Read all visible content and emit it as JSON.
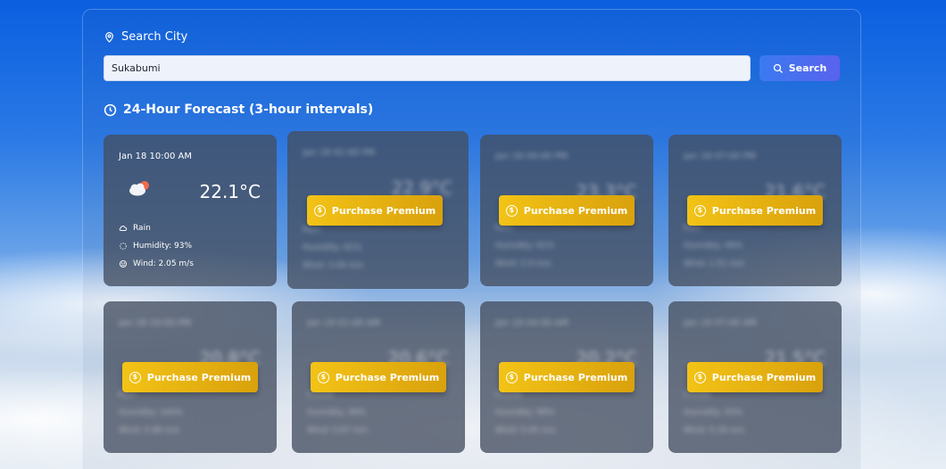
{
  "search": {
    "label": "Search City",
    "value": "Sukabumi",
    "button_label": "Search"
  },
  "forecast": {
    "heading": "24-Hour Forecast (3-hour intervals)",
    "premium_label": "Purchase Premium",
    "cards": [
      {
        "time": "Jan 18 10:00 AM",
        "temp": "22.1°C",
        "condition": "Rain",
        "humidity": "Humidity: 93%",
        "wind": "Wind: 2.05 m/s",
        "locked": false
      },
      {
        "time": "Jan 18 01:00 PM",
        "temp": "22.9°C",
        "condition": "Rain",
        "humidity": "Humidity: 91%",
        "wind": "Wind: 3.04 m/s",
        "locked": true
      },
      {
        "time": "Jan 18 04:00 PM",
        "temp": "23.3°C",
        "condition": "Rain",
        "humidity": "Humidity: 91%",
        "wind": "Wind: 2.4 m/s",
        "locked": true
      },
      {
        "time": "Jan 18 07:00 PM",
        "temp": "21.6°C",
        "condition": "Rain",
        "humidity": "Humidity: 99%",
        "wind": "Wind: 1.51 m/s",
        "locked": true
      },
      {
        "time": "Jan 18 10:00 PM",
        "temp": "20.8°C",
        "condition": "Rain",
        "humidity": "Humidity: 100%",
        "wind": "Wind: 0.88 m/s",
        "locked": true
      },
      {
        "time": "Jan 19 01:00 AM",
        "temp": "20.6°C",
        "condition": "Clouds",
        "humidity": "Humidity: 99%",
        "wind": "Wind: 0.67 m/s",
        "locked": true
      },
      {
        "time": "Jan 19 04:00 AM",
        "temp": "20.2°C",
        "condition": "Clouds",
        "humidity": "Humidity: 99%",
        "wind": "Wind: 0.45 m/s",
        "locked": true
      },
      {
        "time": "Jan 19 07:00 AM",
        "temp": "21.5°C",
        "condition": "Clouds",
        "humidity": "Humidity: 93%",
        "wind": "Wind: 0.18 m/s",
        "locked": true
      }
    ]
  },
  "colors": {
    "accent_search": "#4f6cf0",
    "premium_gold": "#e8b410",
    "card_bg": "#454e60"
  }
}
